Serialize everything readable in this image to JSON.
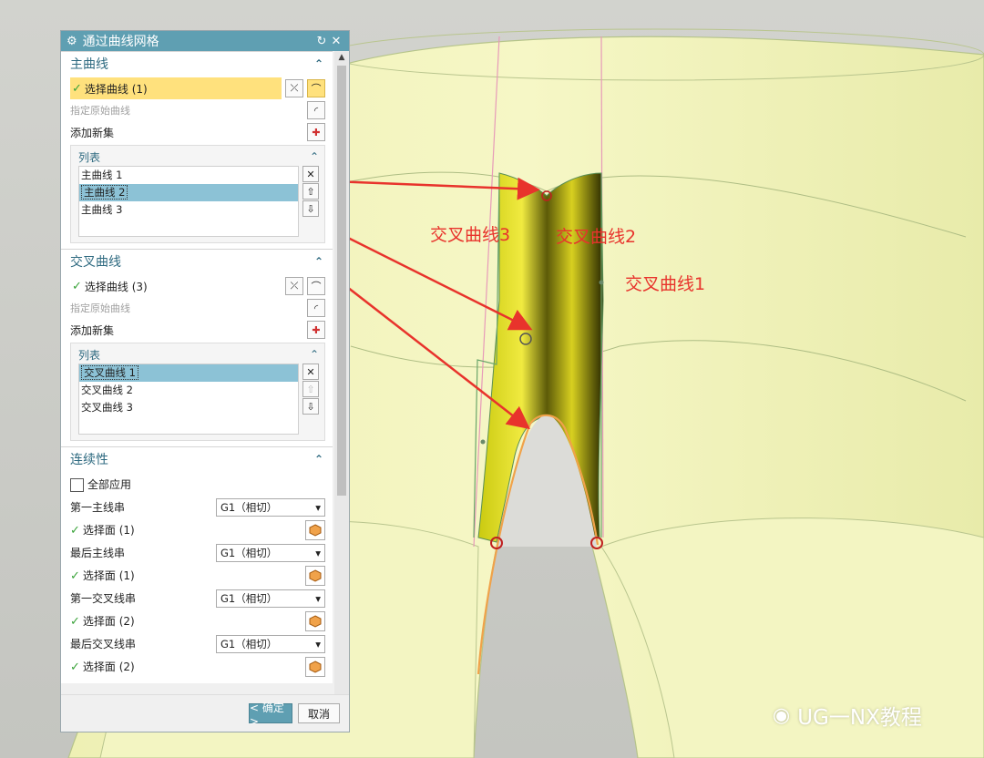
{
  "dialog": {
    "title": "通过曲线网格",
    "primary": {
      "header": "主曲线",
      "select_label": "选择曲线 (1)",
      "origin_label": "指定原始曲线",
      "add_set_label": "添加新集",
      "list_header": "列表",
      "items": [
        "主曲线 1",
        "主曲线 2",
        "主曲线 3"
      ],
      "selected_index": 1
    },
    "cross": {
      "header": "交叉曲线",
      "select_label": "选择曲线 (3)",
      "origin_label": "指定原始曲线",
      "add_set_label": "添加新集",
      "list_header": "列表",
      "items": [
        "交叉曲线 1",
        "交叉曲线 2",
        "交叉曲线 3"
      ],
      "selected_index": 0
    },
    "continuity": {
      "header": "连续性",
      "apply_all_label": "全部应用",
      "apply_all_checked": false,
      "rows": [
        {
          "label": "第一主线串",
          "value": "G1（相切）",
          "face": "选择面 (1)"
        },
        {
          "label": "最后主线串",
          "value": "G1（相切）",
          "face": "选择面 (1)"
        },
        {
          "label": "第一交叉线串",
          "value": "G1（相切）",
          "face": "选择面 (2)"
        },
        {
          "label": "最后交叉线串",
          "value": "G1（相切）",
          "face": "选择面 (2)"
        }
      ]
    },
    "ok_label": "< 确定 >",
    "cancel_label": "取消"
  },
  "annotations": {
    "cross3": "交叉曲线3",
    "cross2": "交叉曲线2",
    "cross1": "交叉曲线1"
  },
  "watermark": "UG一NX教程",
  "colors": {
    "accent": "#5f9fb2",
    "highlight": "#ffe17d",
    "annotation_red": "#e8332c",
    "model_yellow": "#f1f3b6"
  }
}
